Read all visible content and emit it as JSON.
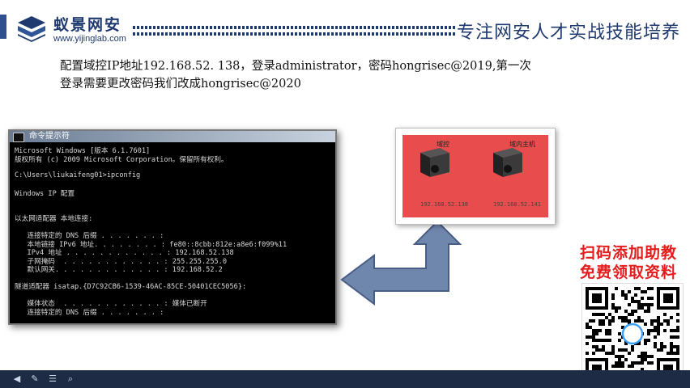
{
  "header": {
    "logo_name": "蚁景网安",
    "logo_url": "www.yijinglab.com",
    "slogan": "专注网安人才实战技能培养"
  },
  "description": {
    "line1": "配置域控IP地址192.168.52. 138，登录administrator，密码hongrisec@2019,第一次",
    "line2": "登录需要更改密码我们改成hongrisec@2020"
  },
  "cmd": {
    "title": "命令提示符",
    "lines": [
      "Microsoft Windows [版本 6.1.7601]",
      "版权所有 (c) 2009 Microsoft Corporation。保留所有权利。",
      "",
      "C:\\Users\\liukaifeng01>ipconfig",
      "",
      "Windows IP 配置",
      "",
      "",
      "以太网适配器 本地连接:",
      "",
      "   连接特定的 DNS 后缀 . . . . . . . :",
      "   本地链接 IPv6 地址. . . . . . . . : fe80::8cbb:812e:a8e6:f099%11",
      "   IPv4 地址 . . . . . . . . . . . . : 192.168.52.138",
      "   子网掩码  . . . . . . . . . . . . : 255.255.255.0",
      "   默认网关. . . . . . . . . . . . . : 192.168.52.2",
      "",
      "隧道适配器 isatap.{D7C92CB6-1539-46AC-85CE-50401CEC5056}:",
      "",
      "   媒体状态  . . . . . . . . . . . . : 媒体已断开",
      "   连接特定的 DNS 后缀 . . . . . . . :"
    ]
  },
  "network": {
    "servers": [
      {
        "label": "域控",
        "ip": "192.168.52.138"
      },
      {
        "label": "域内主机",
        "ip": "192.168.52.141"
      }
    ]
  },
  "promo": {
    "line1": "扫码添加助教",
    "line2": "免费领取资料"
  },
  "colors": {
    "brand": "#1f3a6e",
    "promo": "#e41c1c",
    "network_bg": "#e84c4c",
    "arrow": "#6f86ad"
  },
  "bottom_bar": {
    "icons": [
      "prev-icon",
      "pen-icon",
      "list-icon",
      "zoom-icon"
    ]
  }
}
